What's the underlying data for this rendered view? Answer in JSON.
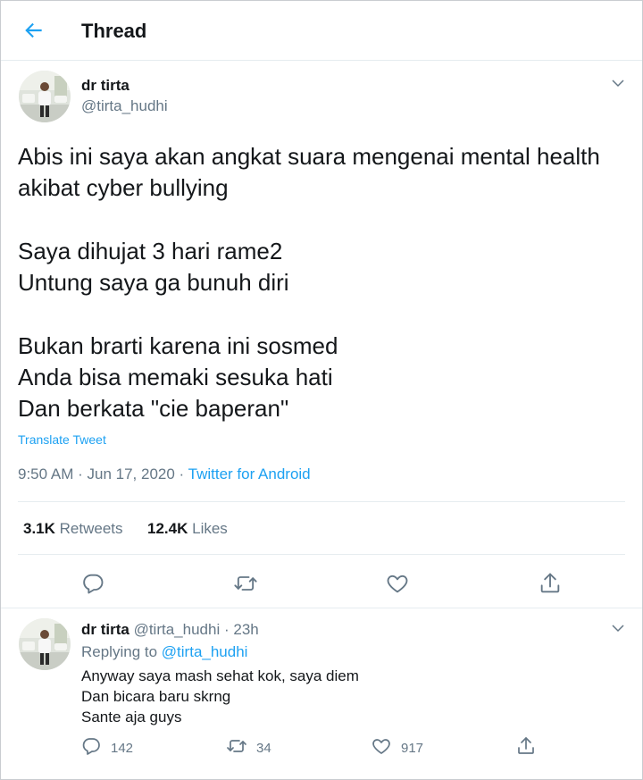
{
  "header": {
    "title": "Thread"
  },
  "tweet": {
    "name": "dr tirta",
    "handle": "@tirta_hudhi",
    "paragraphs": [
      [
        "Abis ini saya akan angkat suara mengenai mental health",
        "akibat cyber bullying"
      ],
      [
        "Saya dihujat 3 hari rame2",
        "Untung saya ga bunuh diri"
      ],
      [
        "Bukan brarti karena ini sosmed",
        "Anda bisa memaki sesuka hati",
        "Dan berkata \"cie baperan\""
      ]
    ],
    "translate_label": "Translate Tweet",
    "time": "9:50 AM",
    "date": "Jun 17, 2020",
    "source": "Twitter for Android",
    "retweets_count": "3.1K",
    "retweets_label": "Retweets",
    "likes_count": "12.4K",
    "likes_label": "Likes"
  },
  "reply": {
    "name": "dr tirta",
    "handle": "@tirta_hudhi",
    "age": "23h",
    "replying_label": "Replying to",
    "replying_to": "@tirta_hudhi",
    "lines": [
      "Anyway saya mash sehat kok, saya diem",
      "Dan bicara baru skrng",
      "Sante aja guys"
    ],
    "replies": "142",
    "retweets": "34",
    "likes": "917"
  },
  "colors": {
    "accent": "#1da1f2",
    "muted": "#657786",
    "text": "#14171a",
    "border": "#e6ecf0"
  },
  "icons": [
    "back-arrow-icon",
    "chevron-down-icon",
    "reply-icon",
    "retweet-icon",
    "like-icon",
    "share-icon"
  ]
}
